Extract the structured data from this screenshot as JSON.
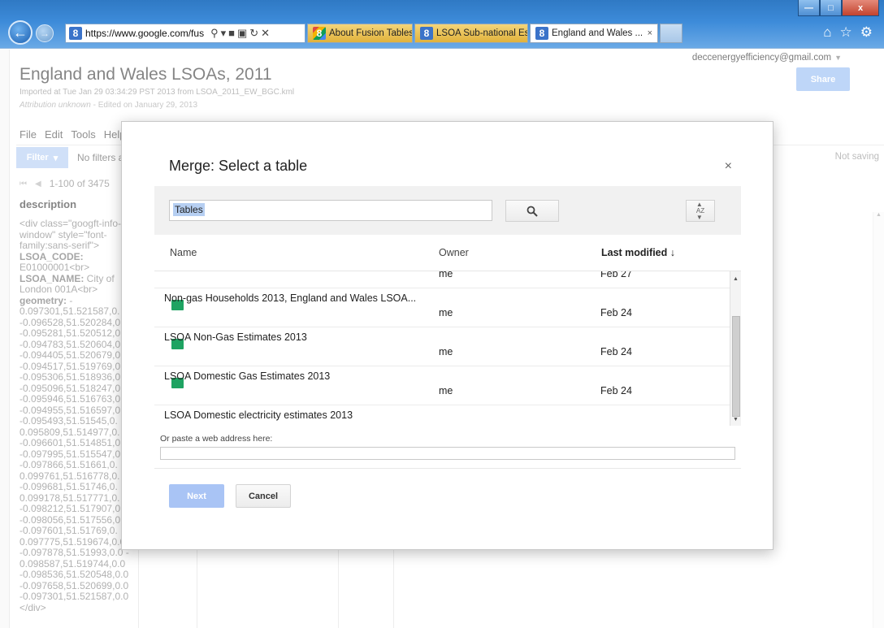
{
  "browser": {
    "url": "https://www.google.com/fus",
    "tabs": [
      {
        "label": "About Fusion Tables - F..."
      },
      {
        "label": "LSOA Sub-national Esti..."
      },
      {
        "label": "England and Wales ...",
        "close": "×"
      }
    ],
    "window_controls": {
      "minimize": "—",
      "maximize": "□",
      "close": "x"
    }
  },
  "page": {
    "account": "deccenergyefficiency@gmail.com",
    "share_label": "Share",
    "title": "England and Wales LSOAs, 2011",
    "imported": "Imported at Tue Jan 29 03:34:29 PST 2013 from LSOA_2011_EW_BGC.kml",
    "attribution": "Attribution unknown",
    "edited": "  -  Edited on January 29, 2013",
    "menu": [
      "File",
      "Edit",
      "Tools",
      "Help"
    ],
    "filter_label": "Filter",
    "no_filters": "No filters a",
    "not_saving": "Not saving",
    "pager_text": "1-100 of 3475",
    "column_header": "description",
    "description_lines": [
      "<div class=\"googft-info-",
      "window\" style=\"font-",
      "family:sans-serif\">",
      "LSOA_CODE:",
      "E01000001<br>",
      "LSOA_NAME: City of",
      "London 001A<br>",
      "geometry: -",
      "0.097301,51.521587,0.",
      "-0.096528,51.520284,0",
      "-0.095281,51.520512,0",
      "-0.094783,51.520604,0",
      "-0.094405,51.520679,0",
      "-0.094517,51.519769,0",
      "-0.095306,51.518936,0",
      "-0.095096,51.518247,0",
      "-0.095946,51.516763,0",
      "-0.094955,51.516597,0",
      "-0.095493,51.51545,0.",
      "0.095809,51.514977,0.",
      "-0.096601,51.514851,0",
      "-0.097995,51.515547,0",
      "-0.097866,51.51661,0.",
      "0.099761,51.516778,0.",
      "-0.099681,51.51746,0.",
      "0.099178,51.517771,0.",
      "-0.098212,51.517907,0",
      "-0.098056,51.517556,0",
      "-0.097601,51.51769,0.",
      "0.097775,51.519674,0.0",
      "-0.097878,51.51993,0.0 -",
      "0.098587,51.519744,0.0",
      "-0.098536,51.520548,0.0",
      "-0.097658,51.520699,0.0",
      "-0.097301,51.521587,0.0",
      "</div>"
    ]
  },
  "modal": {
    "title": "Merge: Select a table",
    "close": "×",
    "search_value": "Tables",
    "columns": {
      "name": "Name",
      "owner": "Owner",
      "modified": "Last modified ↓"
    },
    "rows": [
      {
        "name": "",
        "owner": "me",
        "modified": "Feb 27"
      },
      {
        "name": "Non-gas Households 2013, England and Wales LSOA...",
        "owner": "me",
        "modified": "Feb 24"
      },
      {
        "name": "LSOA Non-Gas Estimates 2013",
        "owner": "me",
        "modified": "Feb 24"
      },
      {
        "name": "LSOA Domestic Gas Estimates 2013",
        "owner": "me",
        "modified": "Feb 24"
      },
      {
        "name": "LSOA Domestic electricity estimates 2013",
        "owner": "",
        "modified": ""
      }
    ],
    "paste_label": "Or paste a web address here:",
    "next_label": "Next",
    "cancel_label": "Cancel"
  },
  "icons": {
    "back": "back-arrow-icon",
    "forward": "forward-arrow-icon",
    "search": "search-icon",
    "sort": "sort-az-icon",
    "home": "home-icon",
    "favorites": "star-icon",
    "settings": "gear-icon",
    "table": "fusion-table-icon"
  },
  "colors": {
    "accent_blue": "#4d90fe",
    "table_icon_green": "#1ea362"
  }
}
